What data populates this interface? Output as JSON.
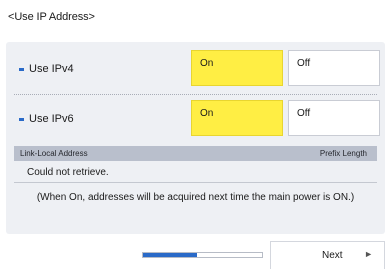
{
  "title": "<Use IP Address>",
  "rows": [
    {
      "label": "Use IPv4",
      "on_label": "On",
      "off_label": "Off",
      "selected": "on"
    },
    {
      "label": "Use IPv6",
      "on_label": "On",
      "off_label": "Off",
      "selected": "on"
    }
  ],
  "table": {
    "headers": [
      "Link-Local Address",
      "Prefix Length"
    ],
    "cell": "Could not retrieve."
  },
  "note": "(When On, addresses will be acquired next time the main power is ON.)",
  "progress": {
    "value": 0.45
  },
  "next_label": "Next",
  "colors": {
    "selected": "#ffee44",
    "accent": "#2a6ac8",
    "header": "#b9bfcc"
  },
  "icons": {
    "row_marker": "bullet-dash",
    "next": "triangle-right-icon"
  }
}
